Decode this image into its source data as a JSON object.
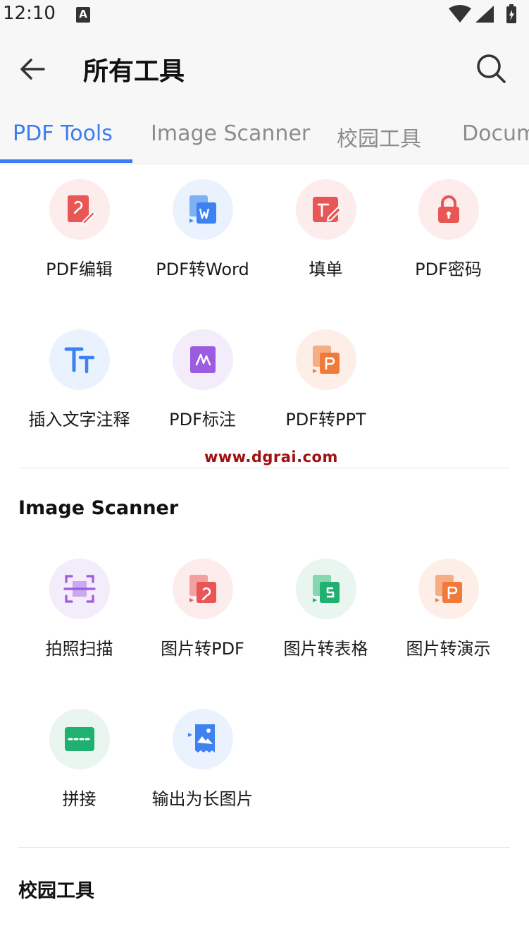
{
  "status": {
    "time": "12:10",
    "notif_label": "A"
  },
  "header": {
    "title": "所有工具"
  },
  "tabs": [
    {
      "label": "PDF Tools",
      "active": true
    },
    {
      "label": "Image Scanner",
      "active": false
    },
    {
      "label": "校园工具",
      "active": false
    },
    {
      "label": "Docum",
      "active": false
    }
  ],
  "pdf_tools": {
    "items": [
      {
        "label": "PDF编辑",
        "icon": "pdf-edit-icon",
        "color": "#e85656"
      },
      {
        "label": "PDF转Word",
        "icon": "pdf-to-word-icon",
        "color": "#3d82f0"
      },
      {
        "label": "填单",
        "icon": "fill-form-icon",
        "color": "#e85656"
      },
      {
        "label": "PDF密码",
        "icon": "lock-icon",
        "color": "#e85656"
      },
      {
        "label": "插入文字注释",
        "icon": "text-comment-icon",
        "color": "#3d82f0"
      },
      {
        "label": "PDF标注",
        "icon": "pdf-annotate-icon",
        "color": "#9c5ce0"
      },
      {
        "label": "PDF转PPT",
        "icon": "pdf-to-ppt-icon",
        "color": "#f07a3a"
      }
    ]
  },
  "watermark": "www.dgrai.com",
  "image_scanner": {
    "title": "Image Scanner",
    "items": [
      {
        "label": "拍照扫描",
        "icon": "scan-icon",
        "color": "#9c5ce0"
      },
      {
        "label": "图片转PDF",
        "icon": "image-to-pdf-icon",
        "color": "#e85656"
      },
      {
        "label": "图片转表格",
        "icon": "image-to-sheet-icon",
        "color": "#20b070"
      },
      {
        "label": "图片转演示",
        "icon": "image-to-ppt-icon",
        "color": "#f07a3a"
      },
      {
        "label": "拼接",
        "icon": "stitch-icon",
        "color": "#20b070"
      },
      {
        "label": "输出为长图片",
        "icon": "long-image-icon",
        "color": "#3d82f0"
      }
    ]
  },
  "campus_tools": {
    "title": "校园工具"
  }
}
